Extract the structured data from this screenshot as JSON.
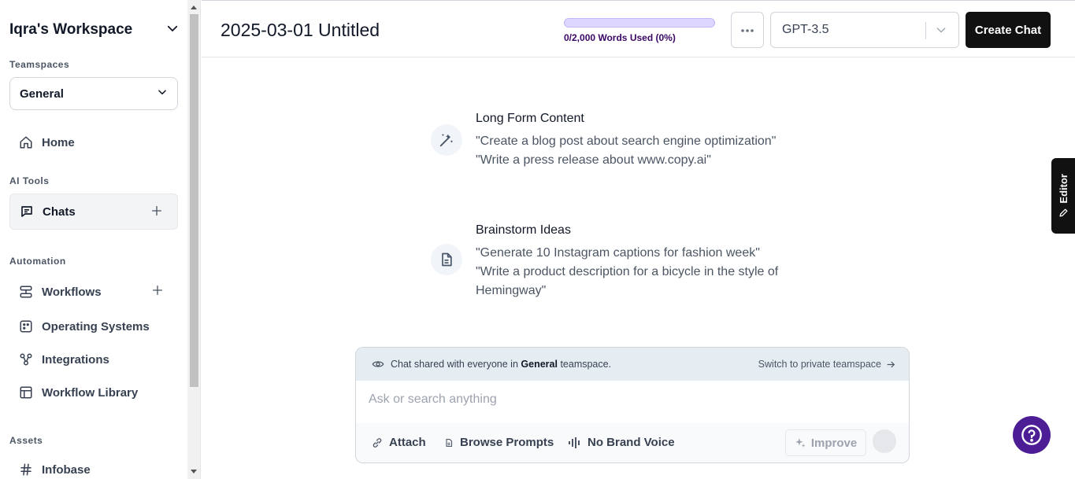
{
  "sidebar": {
    "workspace_title": "Iqra's Workspace",
    "teamspaces_label": "Teamspaces",
    "teamspace_selected": "General",
    "home_label": "Home",
    "ai_tools_label": "AI Tools",
    "chats_label": "Chats",
    "automation_label": "Automation",
    "workflows_label": "Workflows",
    "operating_systems_label": "Operating Systems",
    "integrations_label": "Integrations",
    "workflow_library_label": "Workflow Library",
    "assets_label": "Assets",
    "infobase_label": "Infobase"
  },
  "header": {
    "doc_title": "2025-03-01 Untitled",
    "usage_text": "0/2,000 Words Used (0%)",
    "usage_fraction": 0,
    "model_selected": "GPT-3.5",
    "create_chat_label": "Create Chat"
  },
  "suggestions": [
    {
      "title": "Long Form Content",
      "icon": "magic-wand-icon",
      "lines": [
        "\"Create a blog post about search engine optimization\"",
        "\"Write a press release about www.copy.ai\""
      ]
    },
    {
      "title": "Brainstorm Ideas",
      "icon": "document-icon",
      "lines": [
        "\"Generate 10 Instagram captions for fashion week\"",
        "\"Write a product description for a bicycle in the style of Hemingway\""
      ]
    }
  ],
  "chat": {
    "share_prefix": "Chat shared with everyone in",
    "share_team": "General",
    "share_suffix": "teamspace.",
    "switch_label": "Switch to private teamspace",
    "input_placeholder": "Ask or search anything",
    "attach_label": "Attach",
    "browse_prompts_label": "Browse Prompts",
    "brand_voice_label": "No Brand Voice",
    "improve_label": "Improve"
  },
  "editor_tab_label": "Editor",
  "colors": {
    "accent_purple": "#4c1d95",
    "usage_bar_bg": "#ddd6fe",
    "create_btn_bg": "#111111",
    "share_bar_bg": "#e5edf3"
  }
}
